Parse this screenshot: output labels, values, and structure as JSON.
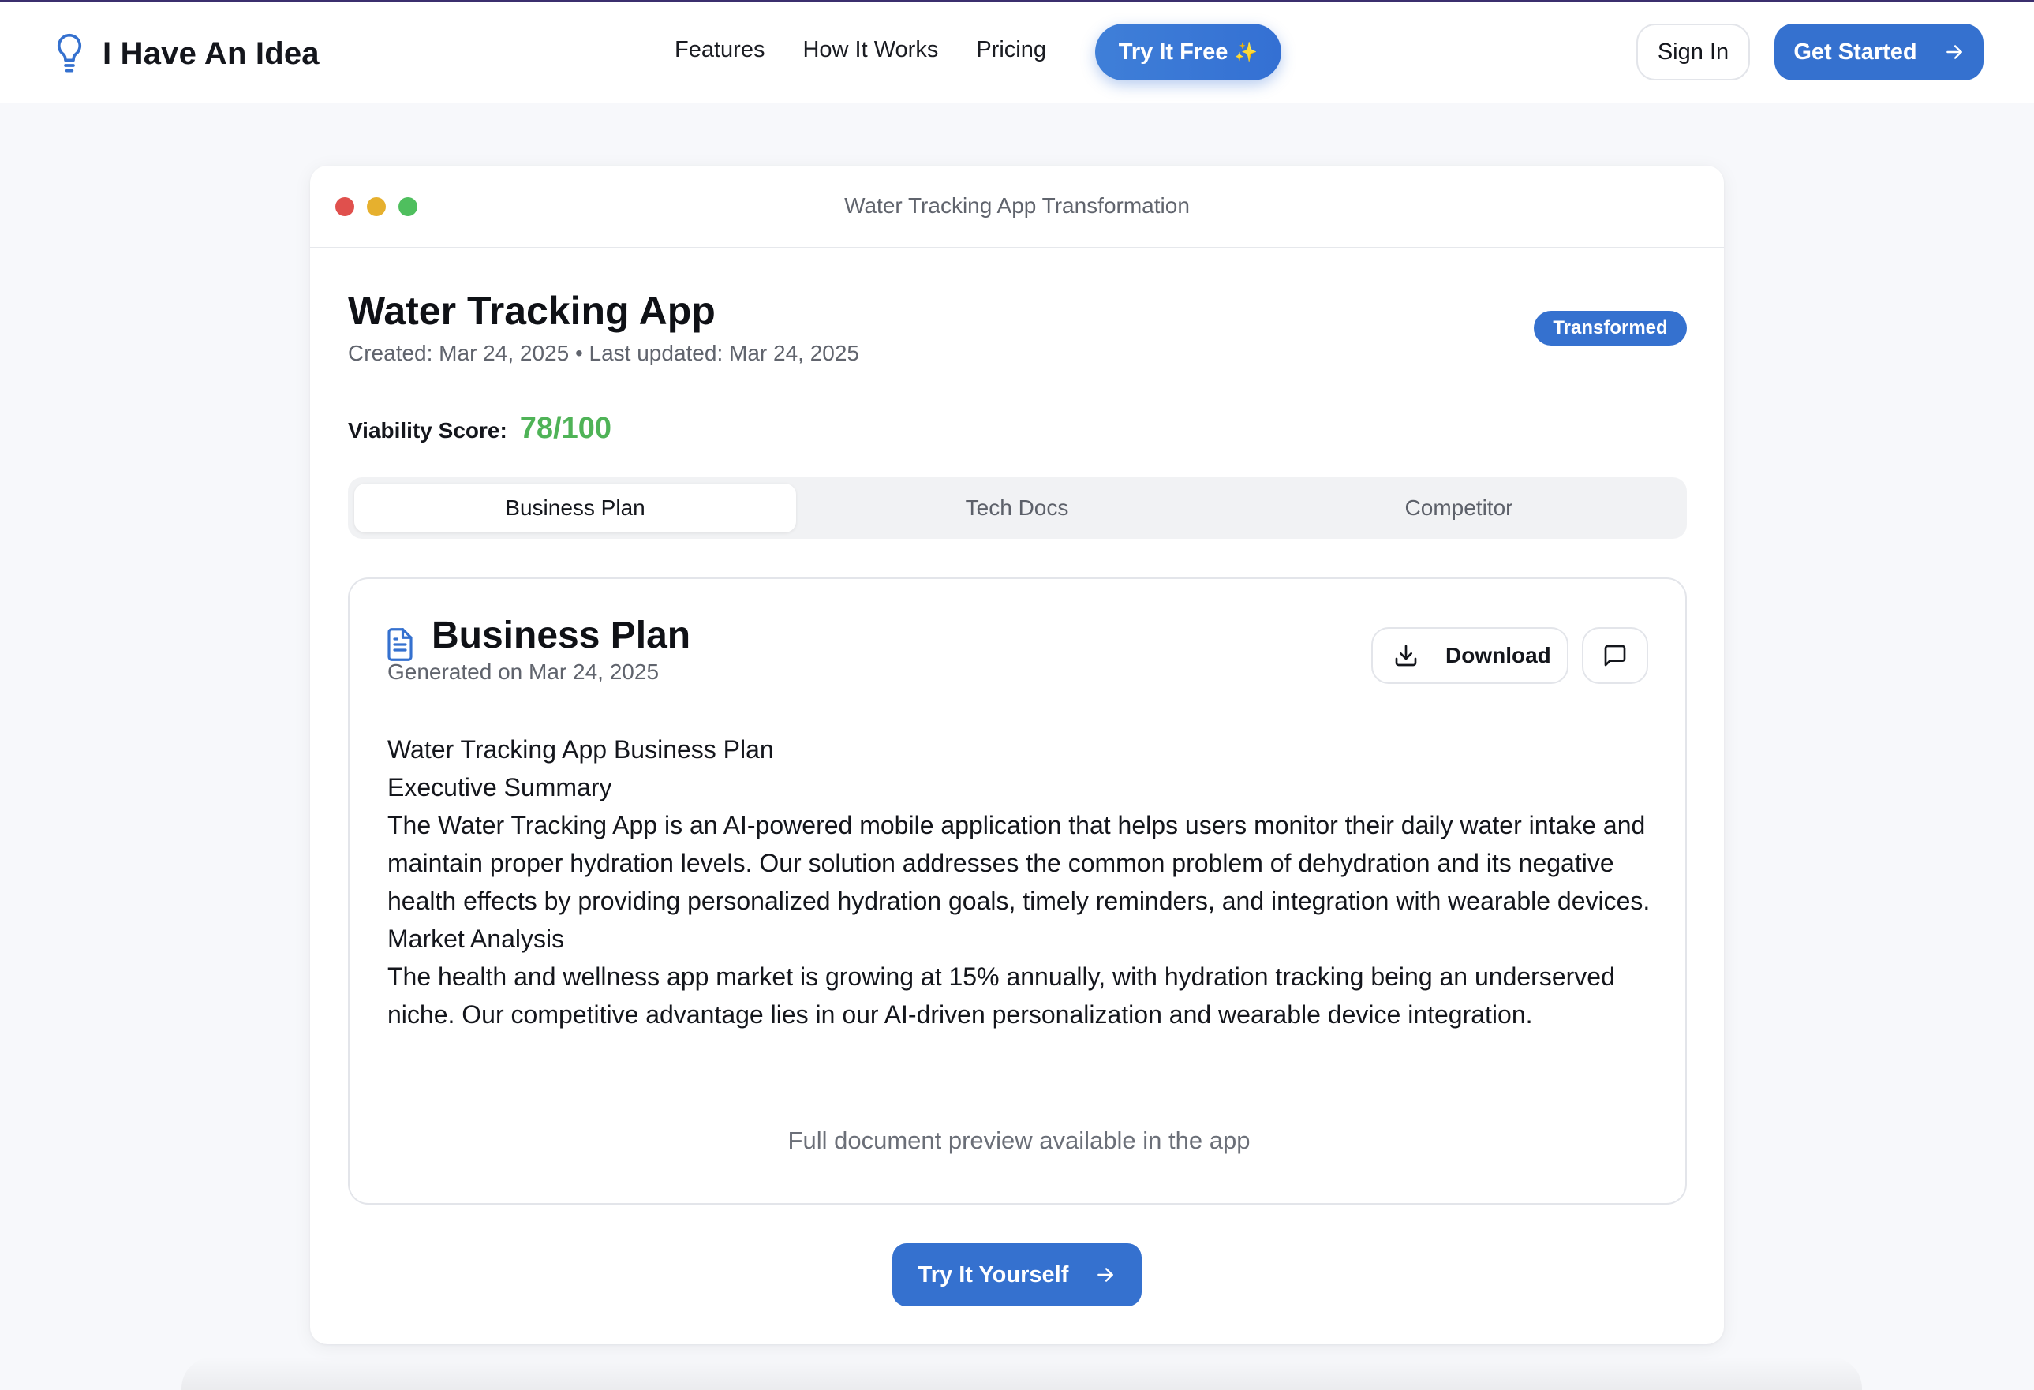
{
  "nav": {
    "brand": "I Have An Idea",
    "links": [
      "Features",
      "How It Works",
      "Pricing"
    ],
    "try_free": "Try It Free",
    "try_free_sparkle": "✨",
    "sign_in": "Sign In",
    "get_started": "Get Started"
  },
  "window": {
    "title": "Water Tracking App Transformation"
  },
  "idea": {
    "title": "Water Tracking App",
    "meta": "Created: Mar 24, 2025 • Last updated: Mar 24, 2025",
    "status_badge": "Transformed",
    "viability_label": "Viability Score:",
    "viability_score": "78/100"
  },
  "tabs": [
    {
      "label": "Business Plan",
      "active": true
    },
    {
      "label": "Tech Docs",
      "active": false
    },
    {
      "label": "Competitor",
      "active": false
    }
  ],
  "document": {
    "title": "Business Plan",
    "generated": "Generated on Mar 24, 2025",
    "download_label": "Download",
    "lines": [
      "Water Tracking App Business Plan",
      "Executive Summary",
      "The Water Tracking App is an AI-powered mobile application that helps users monitor their daily water intake and maintain proper hydration levels. Our solution addresses the common problem of dehydration and its negative health effects by providing personalized hydration goals, timely reminders, and integration with wearable devices.",
      "Market Analysis",
      "The health and wellness app market is growing at 15% annually, with hydration tracking being an underserved niche. Our competitive advantage lies in our AI-driven personalization and wearable device integration."
    ],
    "preview_note": "Full document preview available in the app"
  },
  "cta": {
    "try_yourself": "Try It Yourself"
  },
  "colors": {
    "accent": "#3571cf",
    "score_green": "#4fb357",
    "dot_red": "#e0504d",
    "dot_yellow": "#e6b02e",
    "dot_green": "#4fbf5e"
  }
}
